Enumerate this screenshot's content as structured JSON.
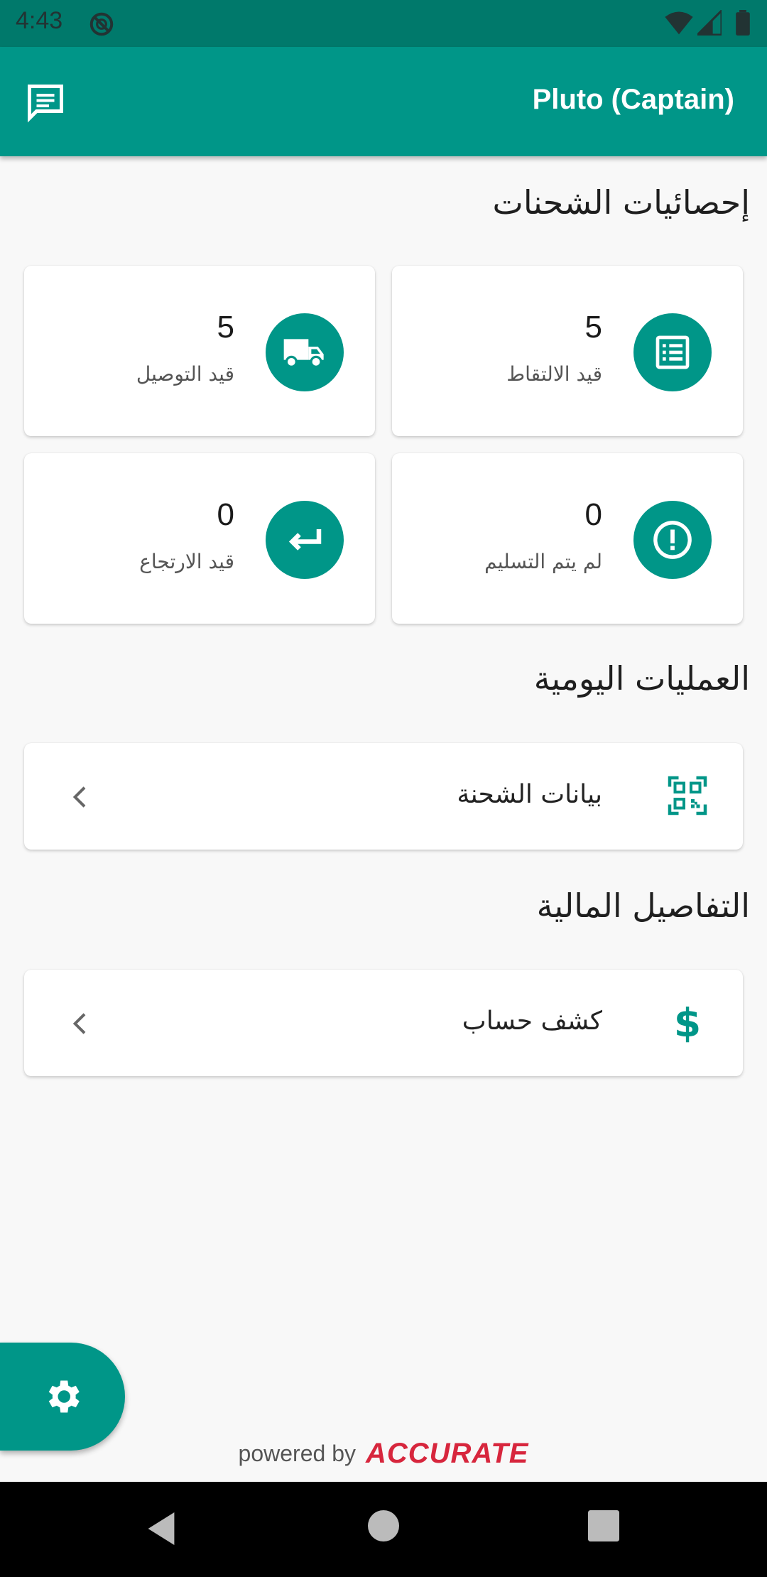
{
  "status_bar": {
    "time": "4:43",
    "icons": [
      "do-not-disturb-icon",
      "wifi-icon",
      "signal-icon",
      "battery-icon"
    ]
  },
  "app_bar": {
    "title": "Pluto (Captain)",
    "left_icon": "chat-icon",
    "background": "#009688"
  },
  "shipment_stats": {
    "title": "إحصائيات الشحنات",
    "cards": [
      {
        "value": "5",
        "label": "قيد الالتقاط",
        "icon": "list-icon"
      },
      {
        "value": "5",
        "label": "قيد التوصيل",
        "icon": "truck-icon"
      },
      {
        "value": "0",
        "label": "لم يتم التسليم",
        "icon": "alert-icon"
      },
      {
        "value": "0",
        "label": "قيد الارتجاع",
        "icon": "return-icon"
      }
    ]
  },
  "daily_operations": {
    "title": "العمليات اليومية",
    "item_label": "بيانات الشحنة",
    "item_icon": "qr-code-icon"
  },
  "financial_details": {
    "title": "التفاصيل المالية",
    "item_label": "كشف حساب",
    "item_icon": "dollar-icon"
  },
  "fab": {
    "icon": "settings-icon"
  },
  "footer": {
    "powered_by": "powered by",
    "brand": "ACCURATE",
    "brand_color": "#d7263d"
  },
  "nav_bar": {
    "icons": [
      "back-icon",
      "home-icon",
      "recents-icon"
    ]
  },
  "colors": {
    "accent": "#009688",
    "status_bar": "#00796b"
  }
}
